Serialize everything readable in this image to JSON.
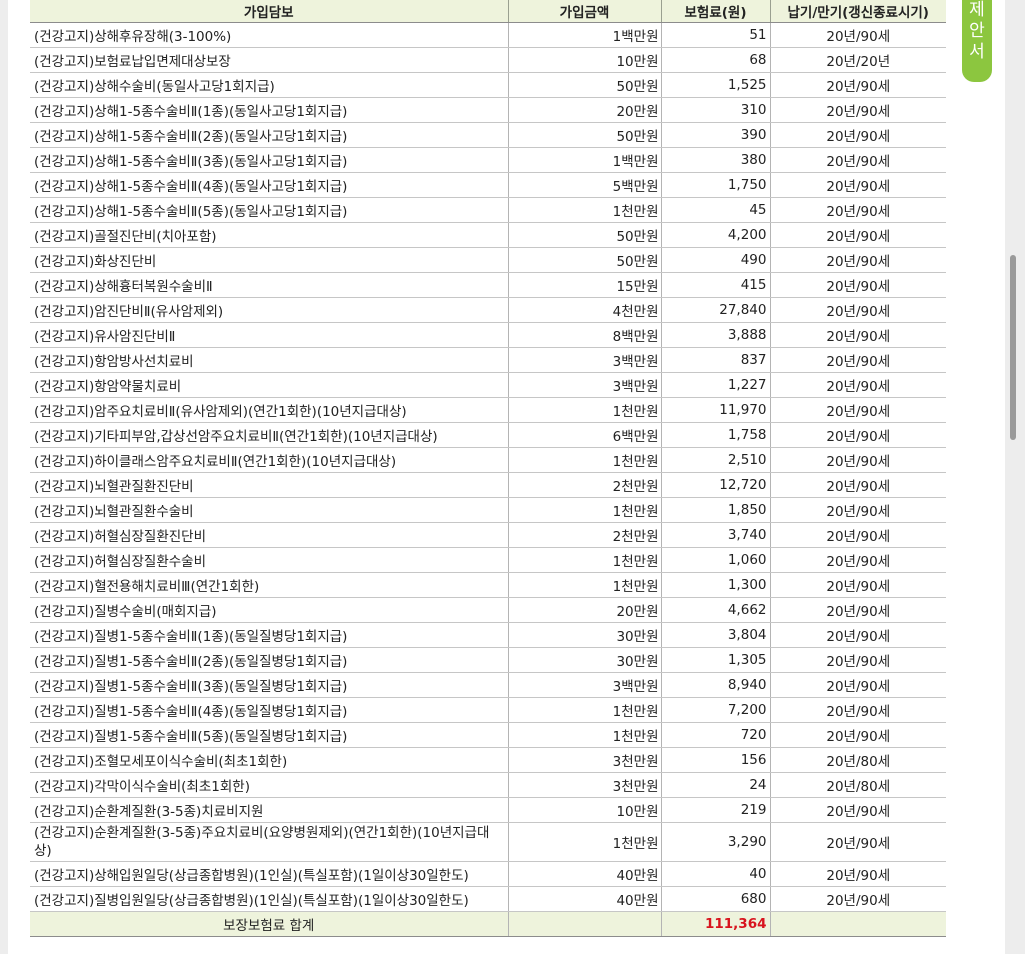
{
  "table": {
    "headers": [
      "가입담보",
      "가입금액",
      "보험료(원)",
      "납기/만기(갱신종료시기)"
    ],
    "rows": [
      {
        "name": "(건강고지)상해후유장해(3-100%)",
        "amount": "1백만원",
        "premium": "51",
        "term": "20년/90세"
      },
      {
        "name": "(건강고지)보험료납입면제대상보장",
        "amount": "10만원",
        "premium": "68",
        "term": "20년/20년"
      },
      {
        "name": "(건강고지)상해수술비(동일사고당1회지급)",
        "amount": "50만원",
        "premium": "1,525",
        "term": "20년/90세"
      },
      {
        "name": "(건강고지)상해1-5종수술비Ⅱ(1종)(동일사고당1회지급)",
        "amount": "20만원",
        "premium": "310",
        "term": "20년/90세"
      },
      {
        "name": "(건강고지)상해1-5종수술비Ⅱ(2종)(동일사고당1회지급)",
        "amount": "50만원",
        "premium": "390",
        "term": "20년/90세"
      },
      {
        "name": "(건강고지)상해1-5종수술비Ⅱ(3종)(동일사고당1회지급)",
        "amount": "1백만원",
        "premium": "380",
        "term": "20년/90세"
      },
      {
        "name": "(건강고지)상해1-5종수술비Ⅱ(4종)(동일사고당1회지급)",
        "amount": "5백만원",
        "premium": "1,750",
        "term": "20년/90세"
      },
      {
        "name": "(건강고지)상해1-5종수술비Ⅱ(5종)(동일사고당1회지급)",
        "amount": "1천만원",
        "premium": "45",
        "term": "20년/90세"
      },
      {
        "name": "(건강고지)골절진단비(치아포함)",
        "amount": "50만원",
        "premium": "4,200",
        "term": "20년/90세"
      },
      {
        "name": "(건강고지)화상진단비",
        "amount": "50만원",
        "premium": "490",
        "term": "20년/90세"
      },
      {
        "name": "(건강고지)상해흉터복원수술비Ⅱ",
        "amount": "15만원",
        "premium": "415",
        "term": "20년/90세"
      },
      {
        "name": "(건강고지)암진단비Ⅱ(유사암제외)",
        "amount": "4천만원",
        "premium": "27,840",
        "term": "20년/90세"
      },
      {
        "name": "(건강고지)유사암진단비Ⅱ",
        "amount": "8백만원",
        "premium": "3,888",
        "term": "20년/90세"
      },
      {
        "name": "(건강고지)항암방사선치료비",
        "amount": "3백만원",
        "premium": "837",
        "term": "20년/90세"
      },
      {
        "name": "(건강고지)항암약물치료비",
        "amount": "3백만원",
        "premium": "1,227",
        "term": "20년/90세"
      },
      {
        "name": "(건강고지)암주요치료비Ⅱ(유사암제외)(연간1회한)(10년지급대상)",
        "amount": "1천만원",
        "premium": "11,970",
        "term": "20년/90세"
      },
      {
        "name": "(건강고지)기타피부암,갑상선암주요치료비Ⅱ(연간1회한)(10년지급대상)",
        "amount": "6백만원",
        "premium": "1,758",
        "term": "20년/90세"
      },
      {
        "name": "(건강고지)하이클래스암주요치료비Ⅱ(연간1회한)(10년지급대상)",
        "amount": "1천만원",
        "premium": "2,510",
        "term": "20년/90세"
      },
      {
        "name": "(건강고지)뇌혈관질환진단비",
        "amount": "2천만원",
        "premium": "12,720",
        "term": "20년/90세"
      },
      {
        "name": "(건강고지)뇌혈관질환수술비",
        "amount": "1천만원",
        "premium": "1,850",
        "term": "20년/90세"
      },
      {
        "name": "(건강고지)허혈심장질환진단비",
        "amount": "2천만원",
        "premium": "3,740",
        "term": "20년/90세"
      },
      {
        "name": "(건강고지)허혈심장질환수술비",
        "amount": "1천만원",
        "premium": "1,060",
        "term": "20년/90세"
      },
      {
        "name": "(건강고지)혈전용해치료비Ⅲ(연간1회한)",
        "amount": "1천만원",
        "premium": "1,300",
        "term": "20년/90세"
      },
      {
        "name": "(건강고지)질병수술비(매회지급)",
        "amount": "20만원",
        "premium": "4,662",
        "term": "20년/90세"
      },
      {
        "name": "(건강고지)질병1-5종수술비Ⅱ(1종)(동일질병당1회지급)",
        "amount": "30만원",
        "premium": "3,804",
        "term": "20년/90세"
      },
      {
        "name": "(건강고지)질병1-5종수술비Ⅱ(2종)(동일질병당1회지급)",
        "amount": "30만원",
        "premium": "1,305",
        "term": "20년/90세"
      },
      {
        "name": "(건강고지)질병1-5종수술비Ⅱ(3종)(동일질병당1회지급)",
        "amount": "3백만원",
        "premium": "8,940",
        "term": "20년/90세"
      },
      {
        "name": "(건강고지)질병1-5종수술비Ⅱ(4종)(동일질병당1회지급)",
        "amount": "1천만원",
        "premium": "7,200",
        "term": "20년/90세"
      },
      {
        "name": "(건강고지)질병1-5종수술비Ⅱ(5종)(동일질병당1회지급)",
        "amount": "1천만원",
        "premium": "720",
        "term": "20년/90세"
      },
      {
        "name": "(건강고지)조혈모세포이식수술비(최초1회한)",
        "amount": "3천만원",
        "premium": "156",
        "term": "20년/80세"
      },
      {
        "name": "(건강고지)각막이식수술비(최초1회한)",
        "amount": "3천만원",
        "premium": "24",
        "term": "20년/80세"
      },
      {
        "name": "(건강고지)순환계질환(3-5종)치료비지원",
        "amount": "10만원",
        "premium": "219",
        "term": "20년/90세"
      },
      {
        "name": "(건강고지)순환계질환(3-5종)주요치료비(요양병원제외)(연간1회한)(10년지급대상)",
        "amount": "1천만원",
        "premium": "3,290",
        "term": "20년/90세"
      },
      {
        "name": "(건강고지)상해입원일당(상급종합병원)(1인실)(특실포함)(1일이상30일한도)",
        "amount": "40만원",
        "premium": "40",
        "term": "20년/90세"
      },
      {
        "name": "(건강고지)질병입원일당(상급종합병원)(1인실)(특실포함)(1일이상30일한도)",
        "amount": "40만원",
        "premium": "680",
        "term": "20년/90세"
      }
    ],
    "total_label": "보장보험료 합계",
    "total_value": "111,364"
  },
  "side_tab": {
    "chars": [
      "제",
      "안",
      "서"
    ],
    "color": "#8cc63f"
  },
  "colors": {
    "total_value": "#d8141e",
    "header_bg": "#eef3dc"
  }
}
